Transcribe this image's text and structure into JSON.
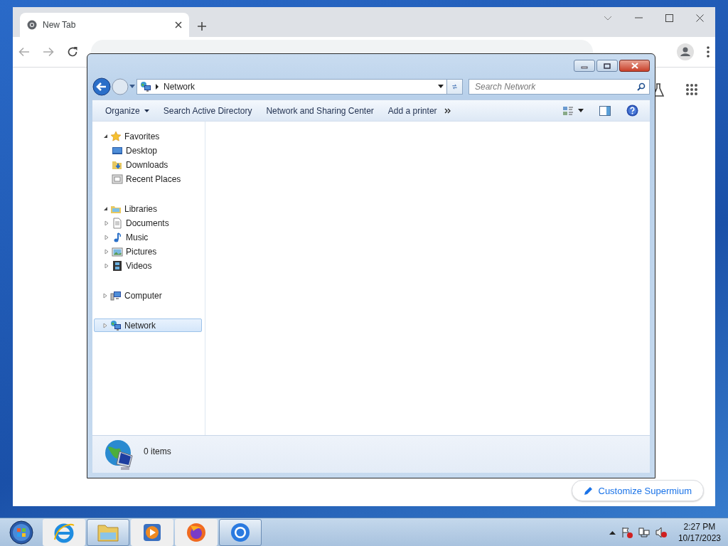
{
  "browser": {
    "tabs": [
      {
        "title": "New Tab",
        "selected": true
      }
    ],
    "customize_button": "Customize Supermium"
  },
  "explorer": {
    "address": "Network",
    "search": {
      "placeholder": "Search Network"
    },
    "toolbar": [
      {
        "label": "Organize",
        "kind": "menu"
      },
      {
        "label": "Search Active Directory",
        "kind": "command"
      },
      {
        "label": "Network and Sharing Center",
        "kind": "command"
      },
      {
        "label": "Add a printer",
        "kind": "command"
      }
    ],
    "nav": [
      {
        "label": "Favorites",
        "kind": "star",
        "expanded": true,
        "selected": false,
        "children": [
          {
            "label": "Desktop",
            "kind": "desktop",
            "selected": false
          },
          {
            "label": "Downloads",
            "kind": "downloads",
            "selected": false
          },
          {
            "label": "Recent Places",
            "kind": "recent",
            "selected": false
          }
        ]
      },
      {
        "label": "Libraries",
        "kind": "library",
        "expanded": true,
        "selected": false,
        "children": [
          {
            "label": "Documents",
            "kind": "documents",
            "expanded": false,
            "selected": false
          },
          {
            "label": "Music",
            "kind": "music",
            "expanded": false,
            "selected": false
          },
          {
            "label": "Pictures",
            "kind": "pictures",
            "expanded": false,
            "selected": false
          },
          {
            "label": "Videos",
            "kind": "videos",
            "expanded": false,
            "selected": false
          }
        ]
      },
      {
        "label": "Computer",
        "kind": "computer",
        "expanded": false,
        "selected": false
      },
      {
        "label": "Network",
        "kind": "network",
        "expanded": false,
        "selected": true
      }
    ],
    "status": "0 items"
  },
  "taskbar": {
    "apps": [
      {
        "kind": "ie",
        "selected": false
      },
      {
        "kind": "explorer",
        "selected": true
      },
      {
        "kind": "media",
        "selected": false
      },
      {
        "kind": "firefox",
        "selected": false
      },
      {
        "kind": "chrome",
        "selected": true
      }
    ],
    "time": "2:27 PM",
    "date": "10/17/2023"
  }
}
